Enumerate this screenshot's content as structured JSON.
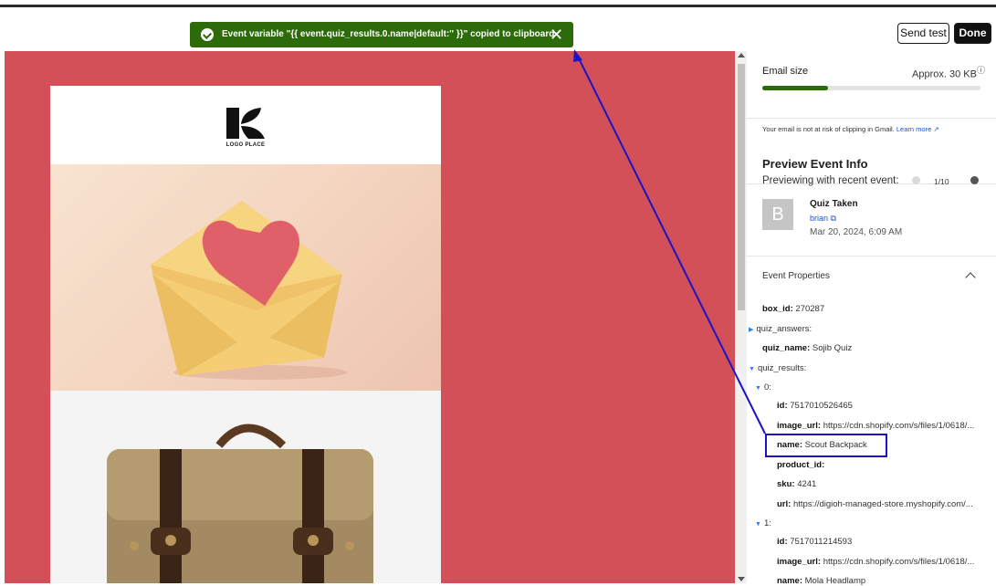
{
  "toast": {
    "message": "Event variable \"{{ event.quiz_results.0.name|default:'' }}\" copied to clipboard",
    "close_glyph": "✕"
  },
  "header": {
    "send_test_label": "Send test",
    "done_label": "Done"
  },
  "email": {
    "logo_text": "LOGO PLACE"
  },
  "panel": {
    "email_size_label": "Email size",
    "email_size_value": "Approx. 30 KB",
    "size_fraction": 0.3,
    "clipping_note": "Your email is not at risk of clipping in Gmail.",
    "learn_more": "Learn more",
    "preview_title": "Preview Event Info",
    "previewing_label": "Previewing with recent event:",
    "event_counter": "1/10",
    "event": {
      "avatar_letter": "B",
      "name": "Quiz Taken",
      "user": "brian",
      "date": "Mar 20, 2024, 6:09 AM"
    },
    "properties_title": "Event Properties",
    "props": {
      "box_id_key": "box_id:",
      "box_id_val": "270287",
      "quiz_answers_key": "quiz_answers:",
      "quiz_name_key": "quiz_name:",
      "quiz_name_val": "Sojib Quiz",
      "quiz_results_key": "quiz_results:",
      "idx0": "0:",
      "r0_id_key": "id:",
      "r0_id_val": "7517010526465",
      "r0_image_key": "image_url:",
      "r0_image_val": "https://cdn.shopify.com/s/files/1/0618/...",
      "r0_name_key": "name:",
      "r0_name_val": "Scout Backpack",
      "r0_product_key": "product_id:",
      "r0_sku_key": "sku:",
      "r0_sku_val": "4241",
      "r0_url_key": "url:",
      "r0_url_val": "https://digioh-managed-store.myshopify.com/...",
      "idx1": "1:",
      "r1_id_key": "id:",
      "r1_id_val": "7517011214593",
      "r1_image_key": "image_url:",
      "r1_image_val": "https://cdn.shopify.com/s/files/1/0618/...",
      "r1_name_key": "name:",
      "r1_name_val": "Mola Headlamp"
    }
  },
  "colors": {
    "canvas_bg": "#d45059",
    "toast_bg": "#2c6a0a",
    "accent_blue": "#1a14c4",
    "link_blue": "#1d4ed8"
  }
}
